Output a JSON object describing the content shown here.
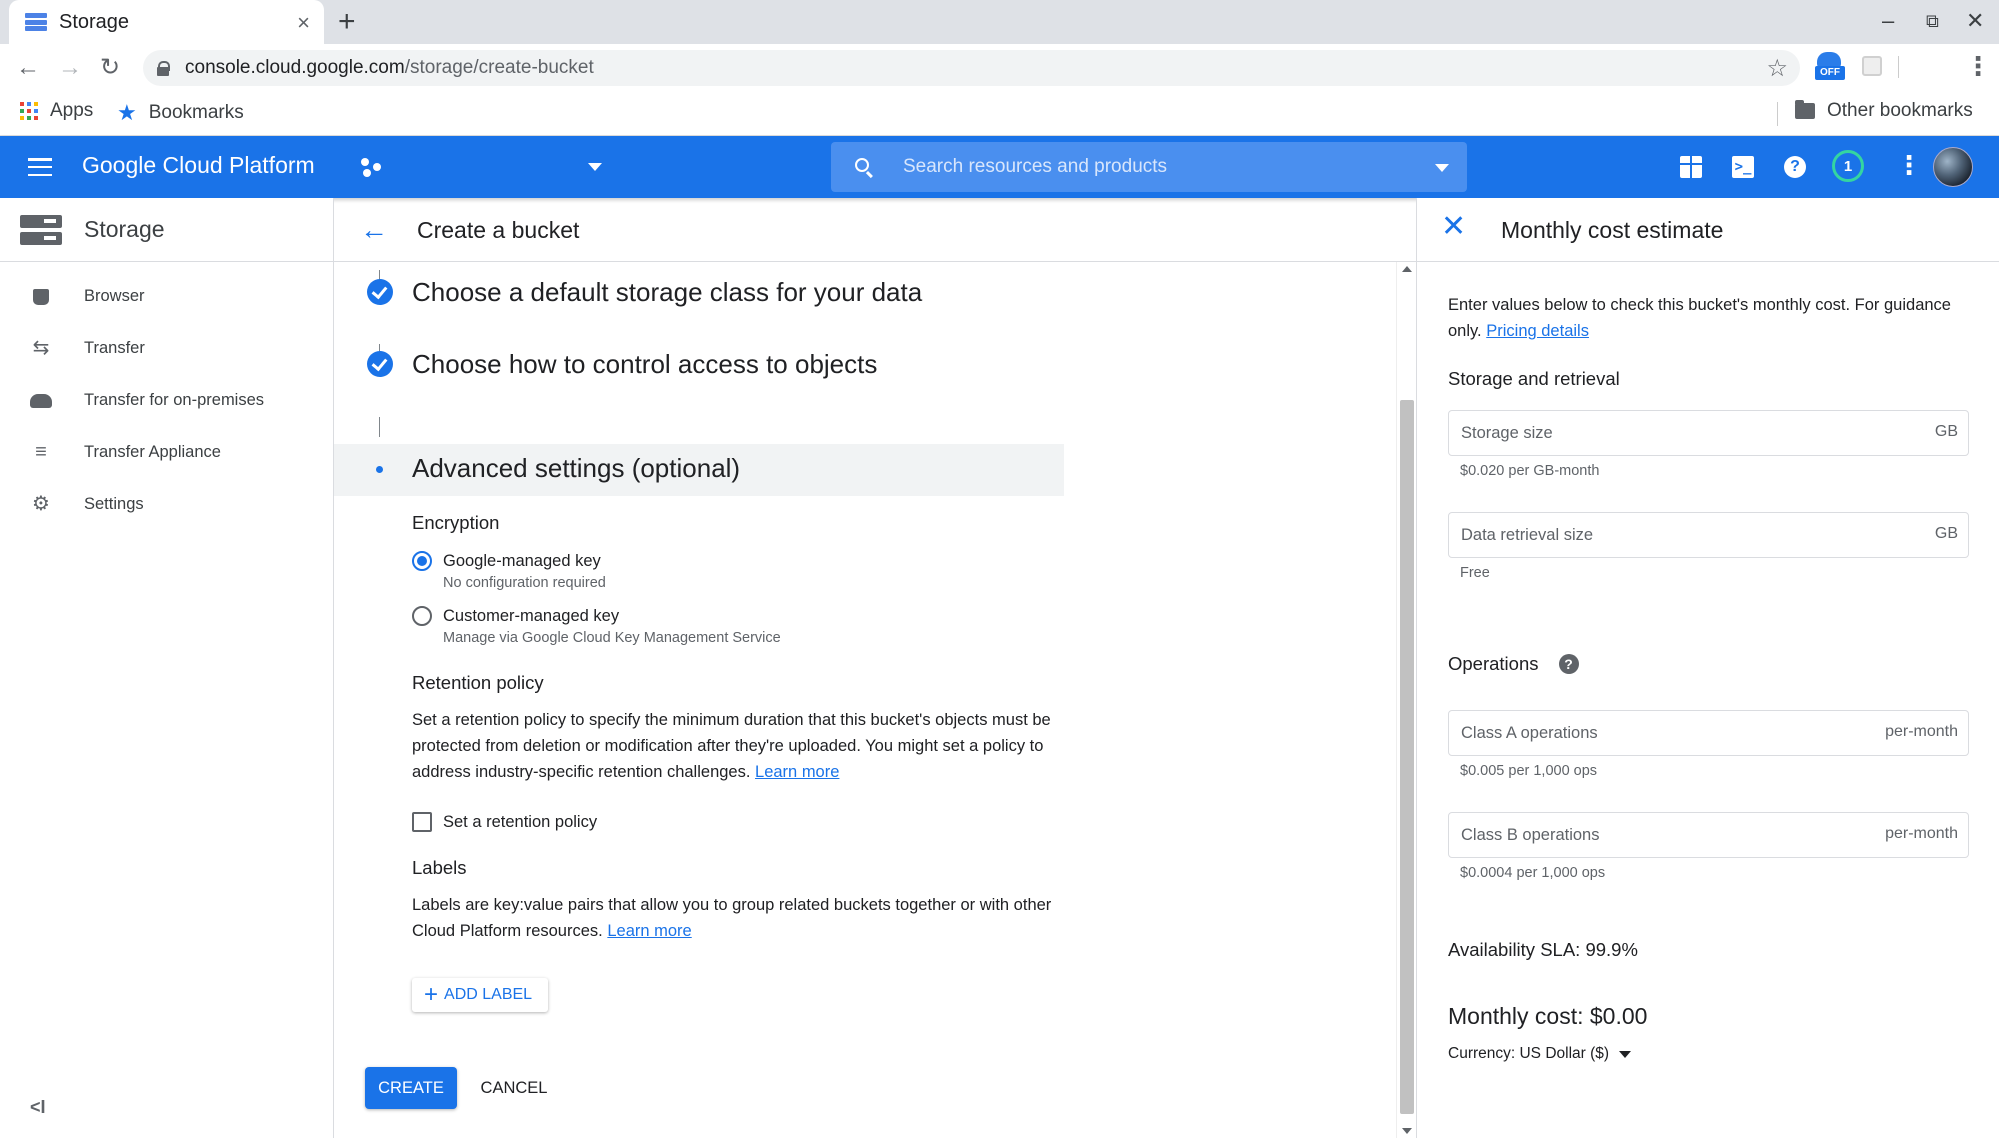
{
  "browser": {
    "tab_title": "Storage",
    "tab_close": "×",
    "new_tab": "+",
    "url_host": "console.cloud.google.com",
    "url_path": "/storage/create-bucket",
    "ext_badge": "OFF",
    "bookmarks": {
      "apps": "Apps",
      "bookmarks": "Bookmarks",
      "other": "Other bookmarks"
    }
  },
  "appbar": {
    "title": "Google Cloud Platform",
    "search_placeholder": "Search resources and products",
    "notification_count": "1",
    "brand_color": "#1a73e8"
  },
  "leftnav": {
    "title": "Storage",
    "items": [
      {
        "label": "Browser",
        "icon": "bucket-icon"
      },
      {
        "label": "Transfer",
        "icon": "transfer-arrows-icon"
      },
      {
        "label": "Transfer for on-premises",
        "icon": "cloud-upload-icon"
      },
      {
        "label": "Transfer Appliance",
        "icon": "list-icon"
      },
      {
        "label": "Settings",
        "icon": "gear-icon"
      }
    ],
    "collapse": "<I"
  },
  "main": {
    "title": "Create a bucket",
    "steps": [
      {
        "title": "Choose a default storage class for your data",
        "done": true
      },
      {
        "title": "Choose how to control access to objects",
        "done": true
      },
      {
        "title": "Advanced settings (optional)",
        "active": true
      }
    ],
    "encryption": {
      "heading": "Encryption",
      "options": [
        {
          "label": "Google-managed key",
          "sub": "No configuration required",
          "selected": true
        },
        {
          "label": "Customer-managed key",
          "sub": "Manage via Google Cloud Key Management Service",
          "selected": false
        }
      ]
    },
    "retention": {
      "heading": "Retention policy",
      "description": "Set a retention policy to specify the minimum duration that this bucket's objects must be protected from deletion or modification after they're uploaded. You might set a policy to address industry-specific retention challenges.",
      "learn_more": "Learn more",
      "checkbox_label": "Set a retention policy"
    },
    "labels": {
      "heading": "Labels",
      "description": "Labels are key:value pairs that allow you to group related buckets together or with other Cloud Platform resources.",
      "learn_more": "Learn more",
      "add_label": "ADD LABEL"
    },
    "create_label": "CREATE",
    "cancel_label": "CANCEL"
  },
  "panel": {
    "title": "Monthly cost estimate",
    "intro": "Enter values below to check this bucket's monthly cost. For guidance only.",
    "pricing_link": "Pricing details",
    "storage_heading": "Storage and retrieval",
    "storage_size": {
      "placeholder": "Storage size",
      "suffix": "GB",
      "hint": "$0.020 per GB-month"
    },
    "retrieval_size": {
      "placeholder": "Data retrieval size",
      "suffix": "GB",
      "hint": "Free"
    },
    "operations_heading": "Operations",
    "class_a": {
      "placeholder": "Class A operations",
      "suffix": "per-month",
      "hint": "$0.005 per 1,000 ops"
    },
    "class_b": {
      "placeholder": "Class B operations",
      "suffix": "per-month",
      "hint": "$0.0004 per 1,000 ops"
    },
    "sla": "Availability SLA: 99.9%",
    "monthly_cost": "Monthly cost: $0.00",
    "currency": "Currency: US Dollar ($)"
  }
}
